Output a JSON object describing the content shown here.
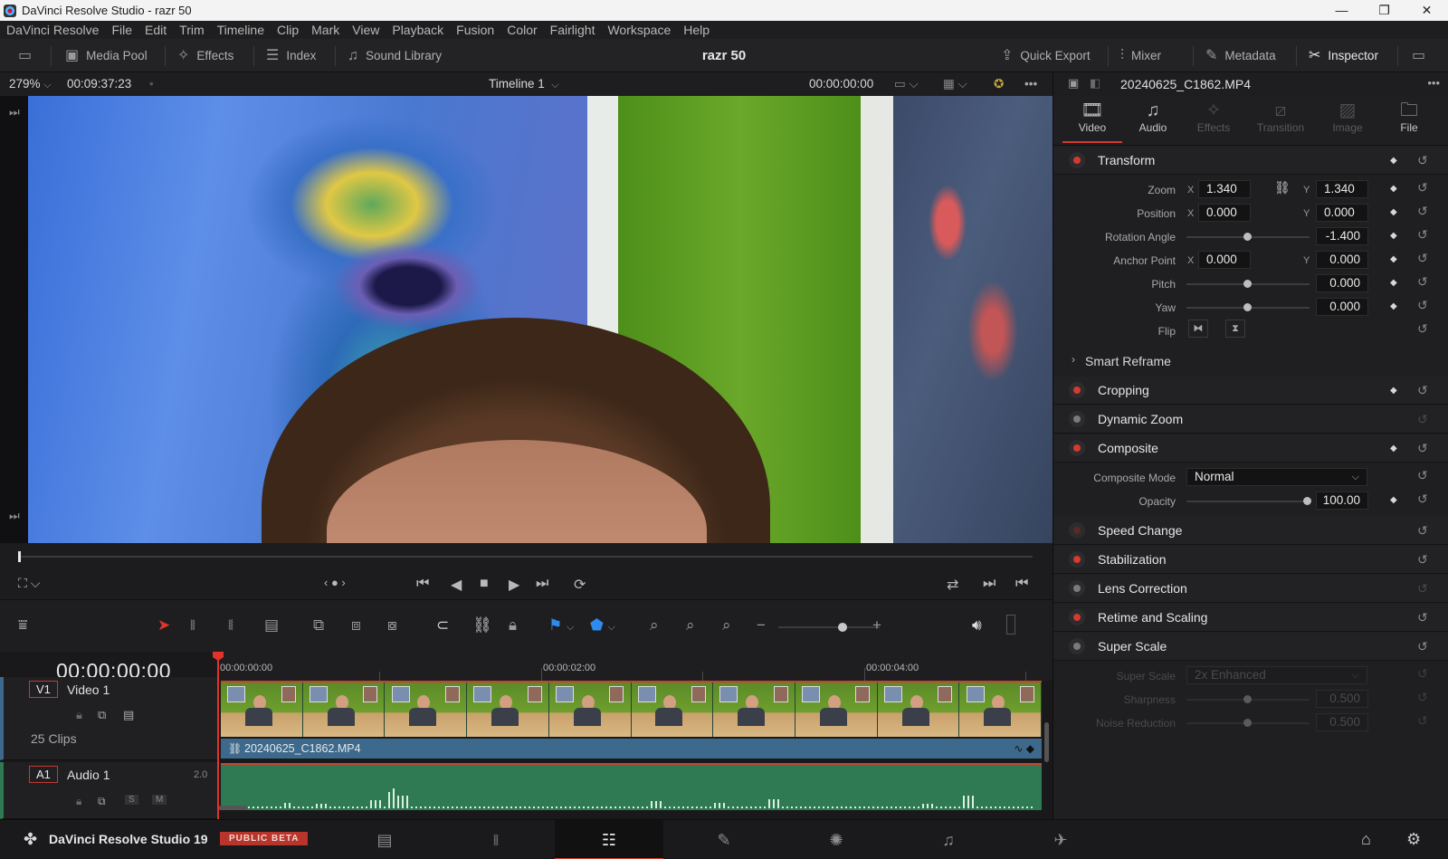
{
  "window": {
    "title": "DaVinci Resolve Studio - razr 50",
    "minimize": "—",
    "maximize": "❐",
    "close": "✕"
  },
  "menu": [
    "DaVinci Resolve",
    "File",
    "Edit",
    "Trim",
    "Timeline",
    "Clip",
    "Mark",
    "View",
    "Playback",
    "Fusion",
    "Color",
    "Fairlight",
    "Workspace",
    "Help"
  ],
  "toolbar": {
    "media_pool": "Media Pool",
    "effects": "Effects",
    "index": "Index",
    "sound_library": "Sound Library",
    "project_name": "razr 50",
    "quick_export": "Quick Export",
    "mixer": "Mixer",
    "metadata": "Metadata",
    "inspector": "Inspector"
  },
  "viewer": {
    "zoom": "279%",
    "duration": "00:09:37:23",
    "timeline_name": "Timeline 1",
    "timecode": "00:00:00:00",
    "playhead_fraction": 0.0
  },
  "timeline": {
    "timecode": "00:00:00:00",
    "ruler": [
      "00:00:00:00",
      "00:00:02:00",
      "00:00:04:00"
    ],
    "video_track": {
      "badge": "V1",
      "name": "Video 1",
      "clips_count": "25 Clips",
      "clip_name": "20240625_C1862.MP4"
    },
    "audio_track": {
      "badge": "A1",
      "name": "Audio 1",
      "channels": "2.0",
      "solo": "S",
      "mute": "M"
    }
  },
  "inspector": {
    "clip_name": "20240625_C1862.MP4",
    "tabs": [
      {
        "label": "Video",
        "icon": "film-icon",
        "active": true
      },
      {
        "label": "Audio",
        "icon": "music-note-icon",
        "active": false
      },
      {
        "label": "Effects",
        "icon": "wand-icon",
        "active": false
      },
      {
        "label": "Transition",
        "icon": "transition-icon",
        "active": false
      },
      {
        "label": "Image",
        "icon": "image-icon",
        "active": false
      },
      {
        "label": "File",
        "icon": "file-icon",
        "active": false
      }
    ],
    "transform": {
      "title": "Transform",
      "zoom_label": "Zoom",
      "zoom_x": "1.340",
      "zoom_y": "1.340",
      "position_label": "Position",
      "position_x": "0.000",
      "position_y": "0.000",
      "rotation_label": "Rotation Angle",
      "rotation": "-1.400",
      "anchor_label": "Anchor Point",
      "anchor_x": "0.000",
      "anchor_y": "0.000",
      "pitch_label": "Pitch",
      "pitch": "0.000",
      "yaw_label": "Yaw",
      "yaw": "0.000",
      "flip_label": "Flip",
      "x": "X",
      "y": "Y"
    },
    "smart_reframe": "Smart Reframe",
    "cropping": "Cropping",
    "dynamic_zoom": "Dynamic Zoom",
    "composite": {
      "title": "Composite",
      "mode_label": "Composite Mode",
      "mode_value": "Normal",
      "opacity_label": "Opacity",
      "opacity": "100.00"
    },
    "speed_change": "Speed Change",
    "stabilization": "Stabilization",
    "lens_correction": "Lens Correction",
    "retime_scaling": "Retime and Scaling",
    "super_scale": {
      "title": "Super Scale",
      "scale_label": "Super Scale",
      "scale_value": "2x Enhanced",
      "sharpness_label": "Sharpness",
      "sharpness": "0.500",
      "noise_label": "Noise Reduction",
      "noise": "0.500"
    }
  },
  "pagebar": {
    "app_name": "DaVinci Resolve Studio 19",
    "beta_badge": "PUBLIC BETA",
    "pages": [
      "media-page",
      "cut-page",
      "edit-page",
      "fusion-page",
      "color-page",
      "fairlight-page",
      "deliver-page"
    ],
    "active_page": "edit-page"
  },
  "colors": {
    "accent_red": "#d13a30",
    "clip_blue": "#3d6a8c",
    "audio_green": "#2f7a52",
    "badge_orange": "#c0392b"
  }
}
